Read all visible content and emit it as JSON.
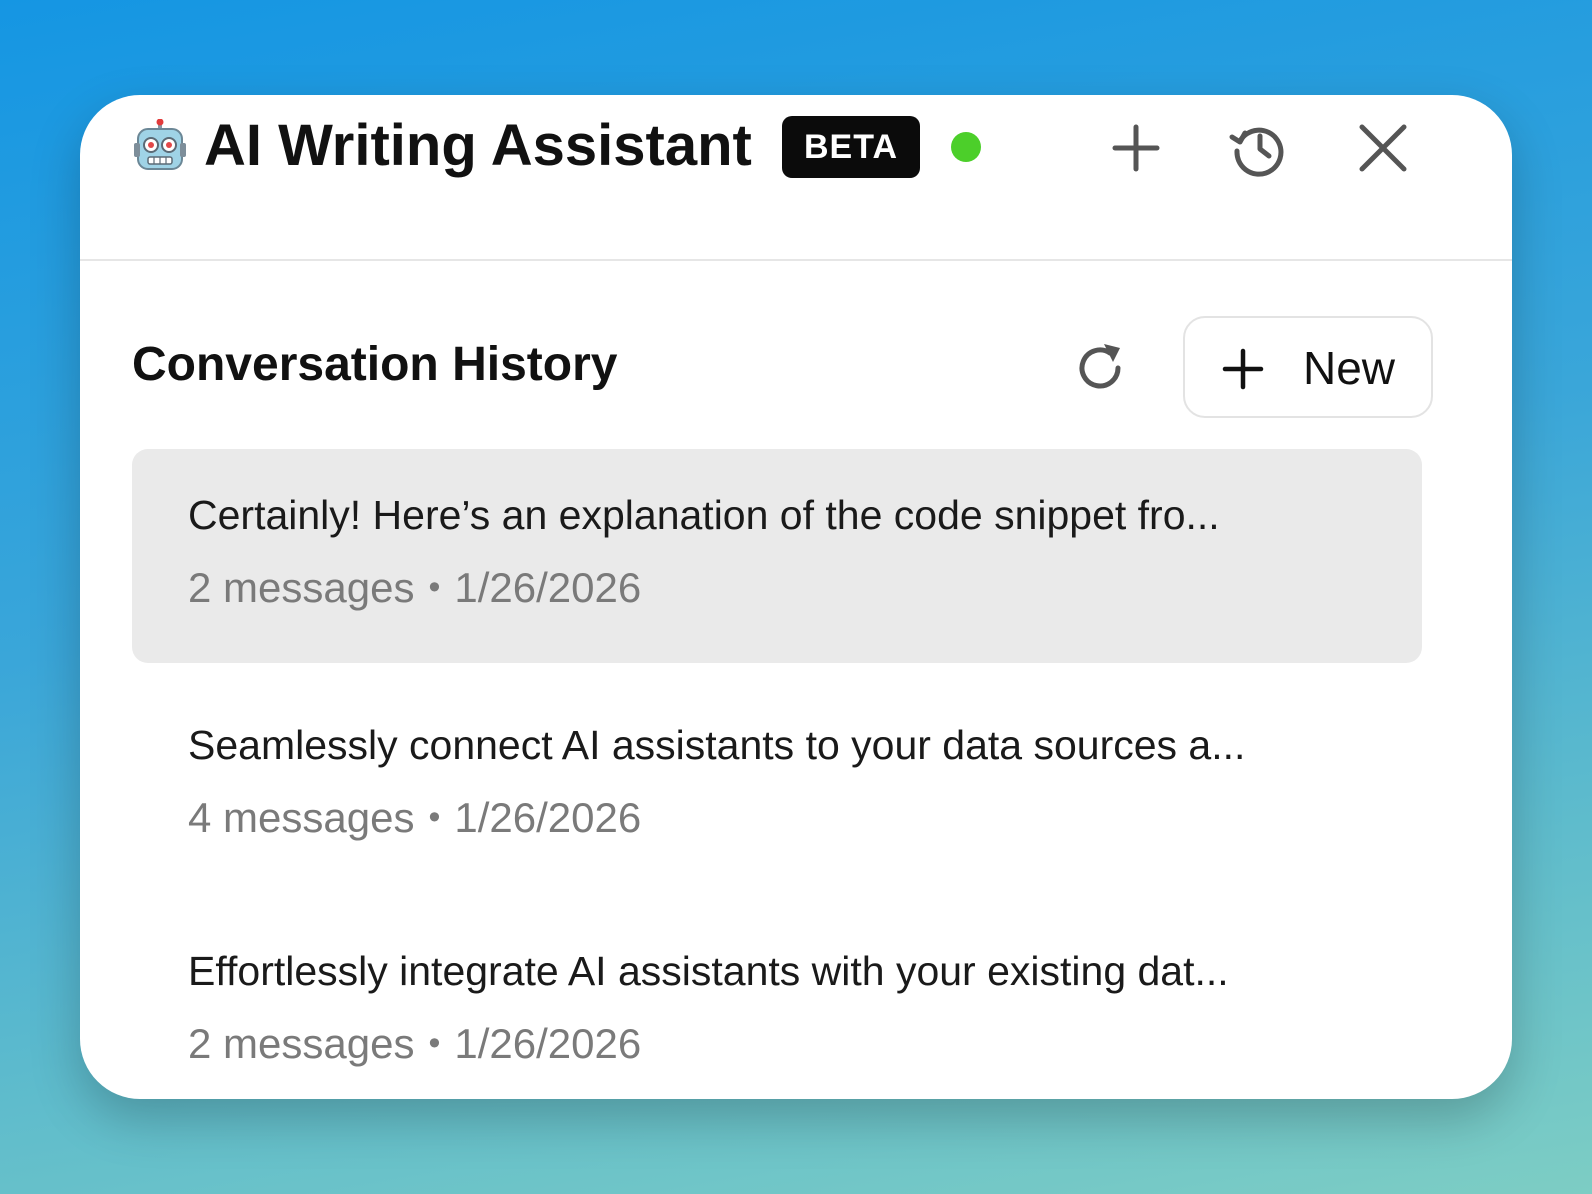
{
  "app": {
    "title": "AI Writing Assistant",
    "badge": "BETA",
    "status_color": "#4ccf2a",
    "icon": "robot-icon"
  },
  "header_actions": {
    "new_chat_icon": "plus-icon",
    "history_icon": "history-icon",
    "close_icon": "close-icon"
  },
  "history": {
    "title": "Conversation History",
    "refresh_icon": "refresh-icon",
    "new_button_label": "New",
    "items": [
      {
        "title": "Certainly! Here’s an explanation of the code snippet fro...",
        "count": "2 messages",
        "date": "1/26/2026",
        "active": true
      },
      {
        "title": "Seamlessly connect AI assistants to your data sources a...",
        "count": "4 messages",
        "date": "1/26/2026",
        "active": false
      },
      {
        "title": "Effortlessly integrate AI assistants with your existing dat...",
        "count": "2 messages",
        "date": "1/26/2026",
        "active": false
      }
    ],
    "separator": "•"
  },
  "colors": {
    "active_row": "#eaeaea",
    "badge_bg": "#0b0b0b",
    "text": "#111111",
    "muted": "#7a7a7a"
  }
}
